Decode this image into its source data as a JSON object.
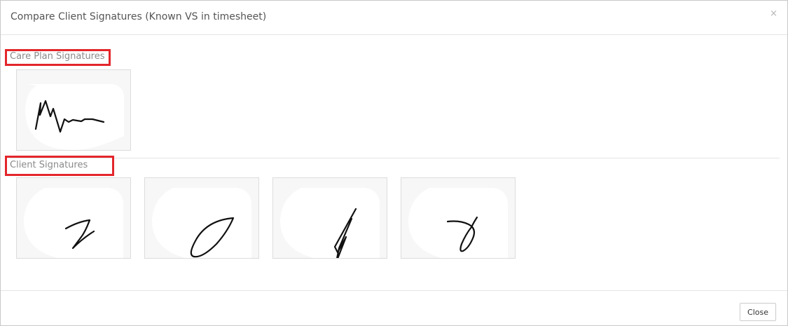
{
  "modal": {
    "title": "Compare Client Signatures (Known VS in timesheet)",
    "close_icon": "×",
    "close_button_label": "Close"
  },
  "sections": {
    "care_plan": {
      "label": "Care Plan Signatures",
      "highlight_color": "#e3262b",
      "signatures": [
        {
          "icon": "signature-scribble-image"
        }
      ]
    },
    "client": {
      "label": "Client Signatures",
      "highlight_color": "#e3262b",
      "signatures": [
        {
          "icon": "signature-z-image"
        },
        {
          "icon": "signature-loop-image"
        },
        {
          "icon": "signature-slash-image"
        },
        {
          "icon": "signature-curl-image"
        }
      ]
    }
  },
  "colors": {
    "highlight": "#e3262b",
    "card_background": "#f7f7f7",
    "card_border": "#dcdcdc"
  }
}
